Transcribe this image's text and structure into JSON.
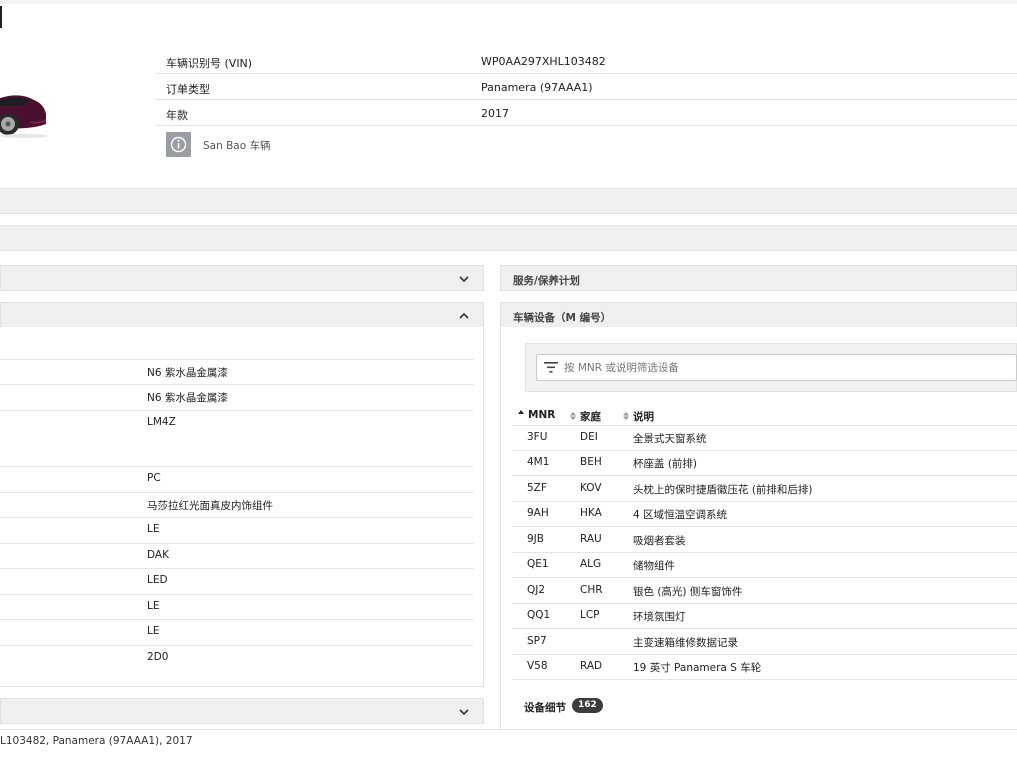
{
  "vehicle": {
    "rows": [
      {
        "label": "车辆识别号 (VIN)",
        "value": "WP0AA297XHL103482"
      },
      {
        "label": "订单类型",
        "value": "Panamera (97AAA1)"
      },
      {
        "label": "年款",
        "value": "2017"
      }
    ],
    "info_chip_icon": "info-icon",
    "info_text": "San Bao 车辆"
  },
  "panels": {
    "service_plan_title": "服务/保养计划",
    "equipment_title": "车辆设备（M 编号）"
  },
  "options": {
    "values": [
      "N6 紫水晶金属漆",
      "N6 紫水晶金属漆",
      "LM4Z",
      "PC",
      "马莎拉红光面真皮内饰组件",
      "LE",
      "DAK",
      "LED",
      "LE",
      "LE",
      "2D0"
    ]
  },
  "equipment": {
    "filter_placeholder": "按 MNR 或说明筛选设备",
    "columns": [
      "MNR",
      "家庭",
      "说明"
    ],
    "rows": [
      {
        "mnr": "3FU",
        "family": "DEI",
        "desc": "全景式天窗系统"
      },
      {
        "mnr": "4M1",
        "family": "BEH",
        "desc": "杯座盖 (前排)"
      },
      {
        "mnr": "5ZF",
        "family": "KOV",
        "desc": "头枕上的保时捷盾徽压花 (前排和后排)"
      },
      {
        "mnr": "9AH",
        "family": "HKA",
        "desc": "4 区域恒温空调系统"
      },
      {
        "mnr": "9JB",
        "family": "RAU",
        "desc": "吸烟者套装"
      },
      {
        "mnr": "QE1",
        "family": "ALG",
        "desc": "储物组件"
      },
      {
        "mnr": "QJ2",
        "family": "CHR",
        "desc": "银色 (高光) 侧车窗饰件"
      },
      {
        "mnr": "QQ1",
        "family": "LCP",
        "desc": "环境氛围灯"
      },
      {
        "mnr": "SP7",
        "family": "",
        "desc": "主变速箱维修数据记录"
      },
      {
        "mnr": "V58",
        "family": "RAD",
        "desc": "19 英寸 Panamera S 车轮"
      }
    ],
    "details_label": "设备细节",
    "details_count": "162"
  },
  "footer": {
    "text": "L103482, Panamera (97AAA1), 2017"
  },
  "colors": {
    "panel_bg": "#efeff0",
    "border": "#e2e2e2",
    "badge": "#3c3c3c",
    "car_body": "#4a1030"
  }
}
